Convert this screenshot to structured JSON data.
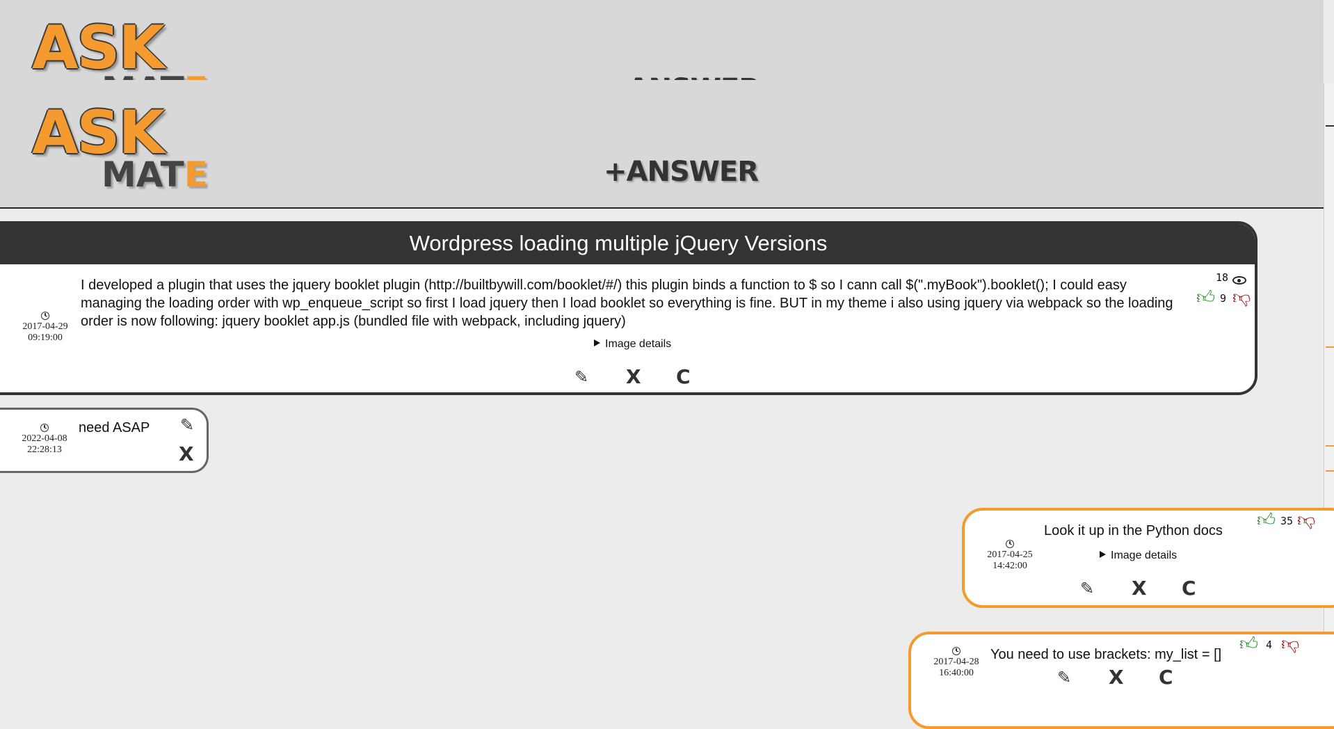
{
  "header": {
    "logo_ask": "ASK",
    "logo_mate_main": "MAT",
    "logo_mate_end": "E",
    "answer_link": "+ANSWER",
    "brand_color": "#f59a2f"
  },
  "question": {
    "title": "Wordpress loading multiple jQuery Versions",
    "date": "2017-04-29",
    "time": "09:19:00",
    "body": "I developed a plugin that uses the jquery booklet plugin (http://builtbywill.com/booklet/#/) this plugin binds a function to $ so I cann call $(\".myBook\").booklet(); I could easy managing the loading order with wp_enqueue_script so first I load jquery then I load booklet so everything is fine. BUT in my theme i also using jquery via webpack so the loading order is now following: jquery booklet app.js (bundled file with webpack, including jquery)",
    "image_details_label": "Image details",
    "views": "18",
    "votes": "9",
    "edit_icon": "pencil-icon",
    "delete_label": "X",
    "comment_label": "C"
  },
  "comment": {
    "date": "2022-04-08",
    "time": "22:28:13",
    "text": "need ASAP",
    "delete_label": "X"
  },
  "answers": [
    {
      "date": "2017-04-25",
      "time": "14:42:00",
      "text": "Look it up in the Python docs",
      "image_details_label": "Image details",
      "votes": "35",
      "delete_label": "X",
      "comment_label": "C"
    },
    {
      "date": "2017-04-28",
      "time": "16:40:00",
      "text": "You need to use brackets: my_list = []",
      "votes": "4",
      "delete_label": "X",
      "comment_label": "C"
    }
  ]
}
